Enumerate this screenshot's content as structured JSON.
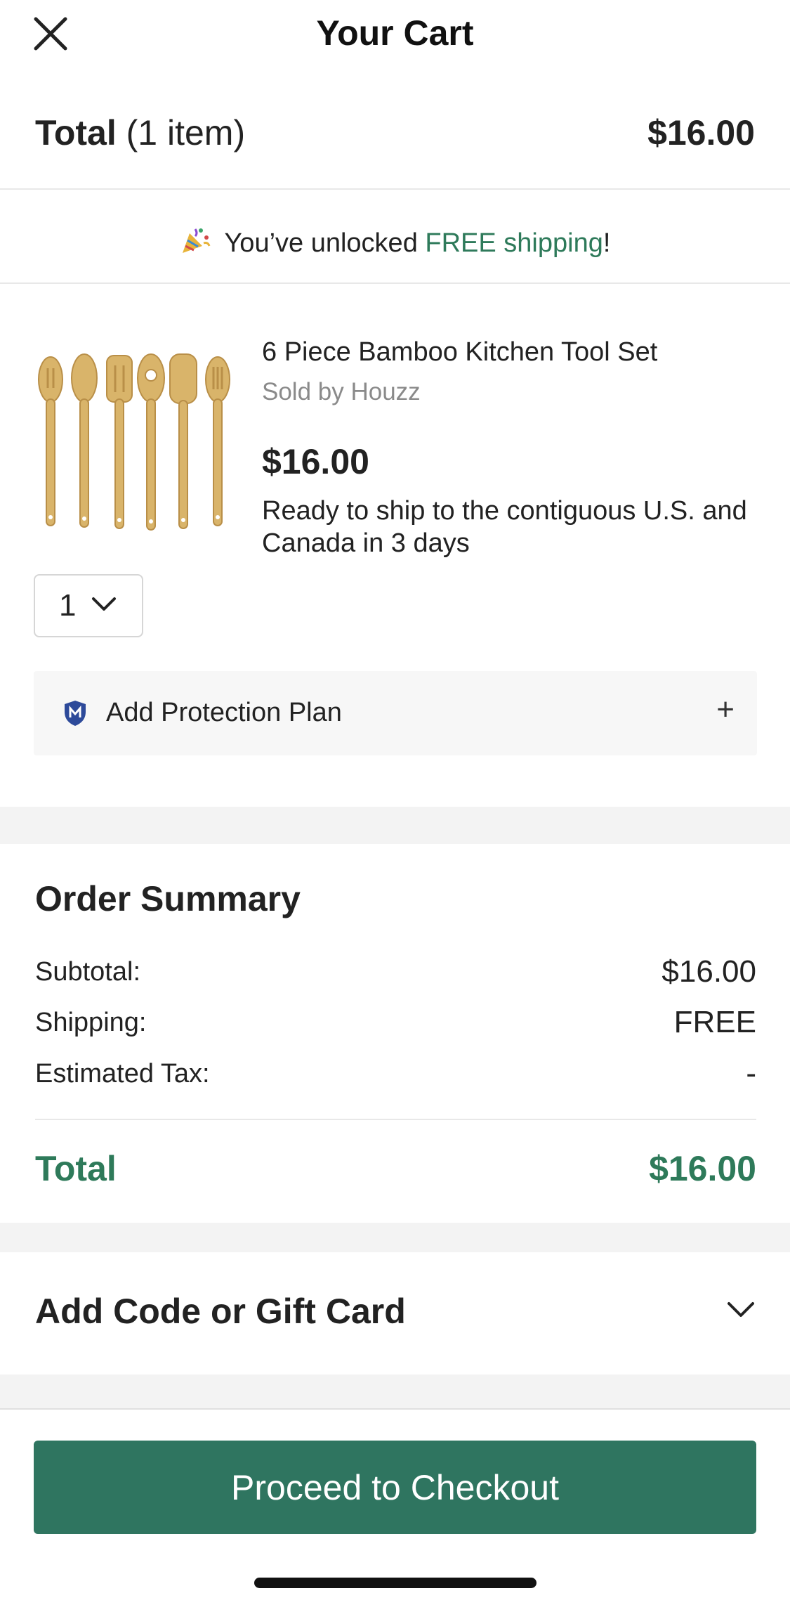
{
  "header": {
    "title": "Your Cart"
  },
  "cart_total": {
    "label": "Total",
    "count": "(1 item)",
    "value": "$16.00"
  },
  "shipping_banner": {
    "prefix": "You’ve unlocked ",
    "highlight": "FREE shipping",
    "suffix": "!"
  },
  "product": {
    "name": "6 Piece Bamboo Kitchen Tool Set",
    "seller": "Sold by Houzz",
    "price": "$16.00",
    "shipping_note": "Ready to ship to the contiguous U.S. and Canada in 3 days",
    "quantity": "1"
  },
  "protection": {
    "label": "Add Protection Plan",
    "action": "+"
  },
  "order_summary": {
    "title": "Order Summary",
    "rows": [
      {
        "label": "Subtotal:",
        "value": "$16.00"
      },
      {
        "label": "Shipping:",
        "value": "FREE"
      },
      {
        "label": "Estimated Tax:",
        "value": "-"
      }
    ],
    "total_label": "Total",
    "total_value": "$16.00"
  },
  "promo": {
    "label": "Add Code or Gift Card"
  },
  "checkout": {
    "label": "Proceed to Checkout"
  },
  "colors": {
    "accent_green": "#2e7a5a",
    "button_green": "#2f7560",
    "band_gray": "#f3f3f3"
  },
  "icons": [
    "close-icon",
    "party-popper-icon",
    "chevron-down-icon",
    "shield-icon",
    "plus-icon"
  ]
}
